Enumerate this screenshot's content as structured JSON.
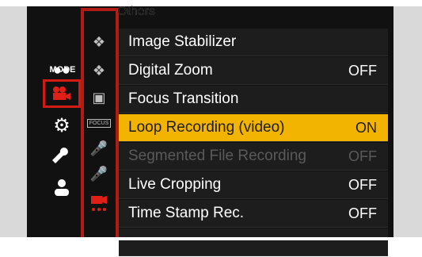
{
  "header": {
    "title": "Others"
  },
  "left_nav": [
    {
      "name": "mode",
      "label": "MODE"
    },
    {
      "name": "video",
      "label": ""
    },
    {
      "name": "settings",
      "label": ""
    },
    {
      "name": "custom",
      "label": ""
    },
    {
      "name": "mymenu",
      "label": ""
    }
  ],
  "sub_nav": {
    "focus_label": "FOCUS"
  },
  "menu": [
    {
      "label": "Image Stabilizer",
      "value": "",
      "state": "normal"
    },
    {
      "label": "Digital Zoom",
      "value": "OFF",
      "state": "normal"
    },
    {
      "label": "Focus Transition",
      "value": "",
      "state": "normal"
    },
    {
      "label": "Loop Recording (video)",
      "value": "ON",
      "state": "selected"
    },
    {
      "label": "Segmented File Recording",
      "value": "OFF",
      "state": "disabled"
    },
    {
      "label": "Live Cropping",
      "value": "OFF",
      "state": "normal"
    },
    {
      "label": "Time Stamp Rec.",
      "value": "OFF",
      "state": "normal"
    }
  ],
  "colors": {
    "accent_red": "#d01c12",
    "highlight": "#f2b400",
    "screen_bg": "#111111"
  }
}
